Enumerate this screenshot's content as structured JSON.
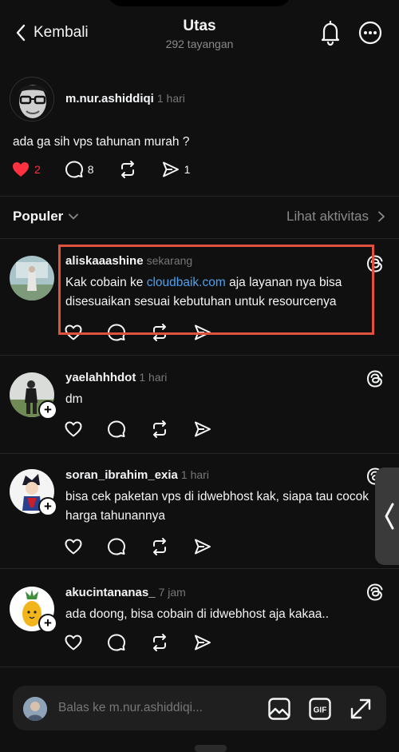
{
  "header": {
    "back_label": "Kembali",
    "title": "Utas",
    "subtitle": "292 tayangan"
  },
  "post": {
    "username": "m.nur.ashiddiqi",
    "time": "1 hari",
    "text": "ada ga sih vps tahunan murah ?",
    "likes": "2",
    "comments": "8",
    "shares": "1"
  },
  "sort": {
    "label": "Populer",
    "activity_label": "Lihat aktivitas"
  },
  "replies": [
    {
      "username": "aliskaaashine",
      "time": "sekarang",
      "text_before": "Kak cobain ke ",
      "link": "cloudbaik.com",
      "text_after": " aja layanan nya bisa disesuaikan sesuai kebutuhan untuk resourcenya"
    },
    {
      "username": "yaelahhhdot",
      "time": "1 hari",
      "text": "dm"
    },
    {
      "username": "soran_ibrahim_exia",
      "time": "1 hari",
      "text": "bisa cek paketan vps di idwebhost kak, siapa tau cocok harga tahunannya"
    },
    {
      "username": "akucintananas_",
      "time": "7 jam",
      "text": "ada doong, bisa cobain di idwebhost aja kakaa.."
    }
  ],
  "composer": {
    "placeholder": "Balas ke m.nur.ashiddiqi..."
  },
  "colors": {
    "background": "#101010",
    "like_red": "#ff3040",
    "link_blue": "#4ba1f0",
    "highlight_box": "#e1523e"
  }
}
